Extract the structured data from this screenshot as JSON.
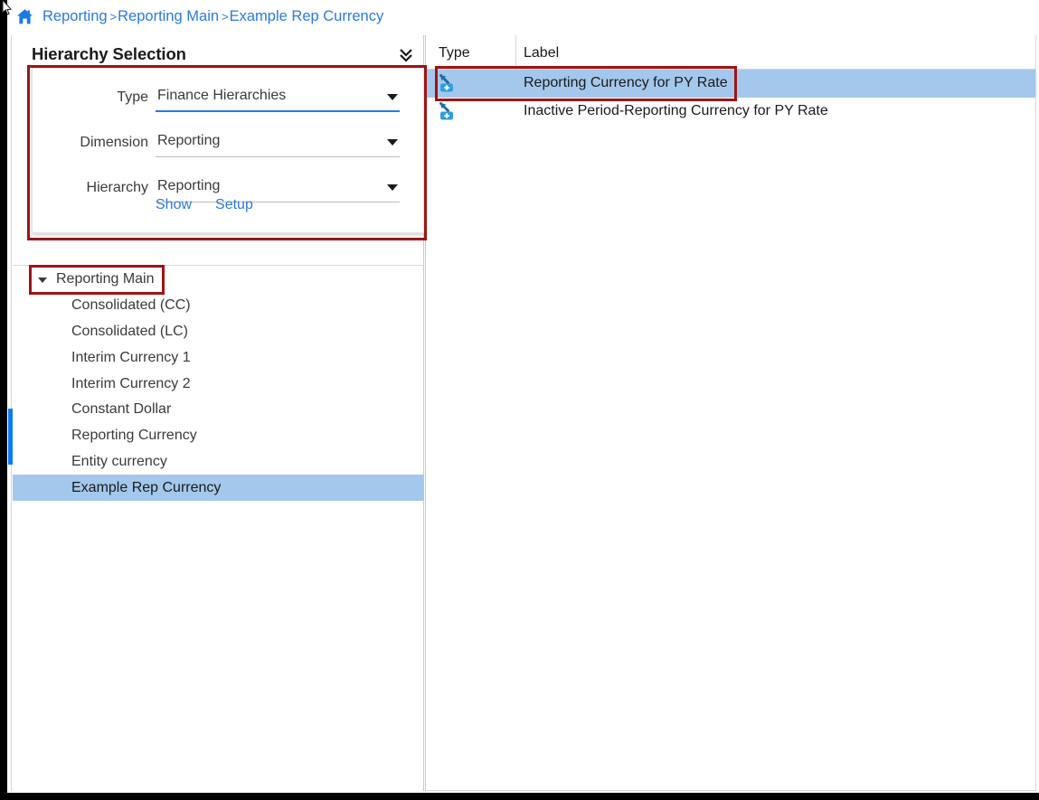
{
  "breadcrumb": {
    "home_icon": "home-icon",
    "separator": ">",
    "items": [
      {
        "label": "Reporting"
      },
      {
        "label": "Reporting Main"
      },
      {
        "label": "Example Rep Currency"
      }
    ]
  },
  "left_panel": {
    "title": "Hierarchy Selection",
    "collapse_icon": "double-chevron-down-icon",
    "fields": [
      {
        "label": "Type",
        "value": "Finance Hierarchies",
        "focused": true
      },
      {
        "label": "Dimension",
        "value": "Reporting",
        "focused": false
      },
      {
        "label": "Hierarchy",
        "value": "Reporting",
        "focused": false
      }
    ],
    "actions": [
      {
        "label": "Show"
      },
      {
        "label": "Setup"
      }
    ],
    "tree": {
      "root": {
        "label": "Reporting Main",
        "expanded": true
      },
      "children": [
        {
          "label": "Consolidated (CC)",
          "selected": false
        },
        {
          "label": "Consolidated (LC)",
          "selected": false
        },
        {
          "label": "Interim Currency 1",
          "selected": false
        },
        {
          "label": "Interim Currency 2",
          "selected": false
        },
        {
          "label": "Constant Dollar",
          "selected": false
        },
        {
          "label": "Reporting Currency",
          "selected": false
        },
        {
          "label": "Entity currency",
          "selected": false
        },
        {
          "label": "Example Rep Currency",
          "selected": true
        }
      ]
    }
  },
  "right_panel": {
    "columns": [
      {
        "label": "Type"
      },
      {
        "label": "Label"
      }
    ],
    "rows": [
      {
        "icon": "add-member-icon",
        "label": "Reporting Currency for PY Rate",
        "selected": true
      },
      {
        "icon": "add-member-icon",
        "label": "Inactive Period-Reporting Currency for PY Rate",
        "selected": false
      }
    ]
  },
  "colors": {
    "link_blue": "#2a7ade",
    "selection_blue": "#a3c8ec",
    "annotation_red": "#9e1414",
    "icon_blue": "#2e9fe0",
    "focus_underline": "#2a7ade",
    "scroll_thumb": "#0a7cf0"
  }
}
